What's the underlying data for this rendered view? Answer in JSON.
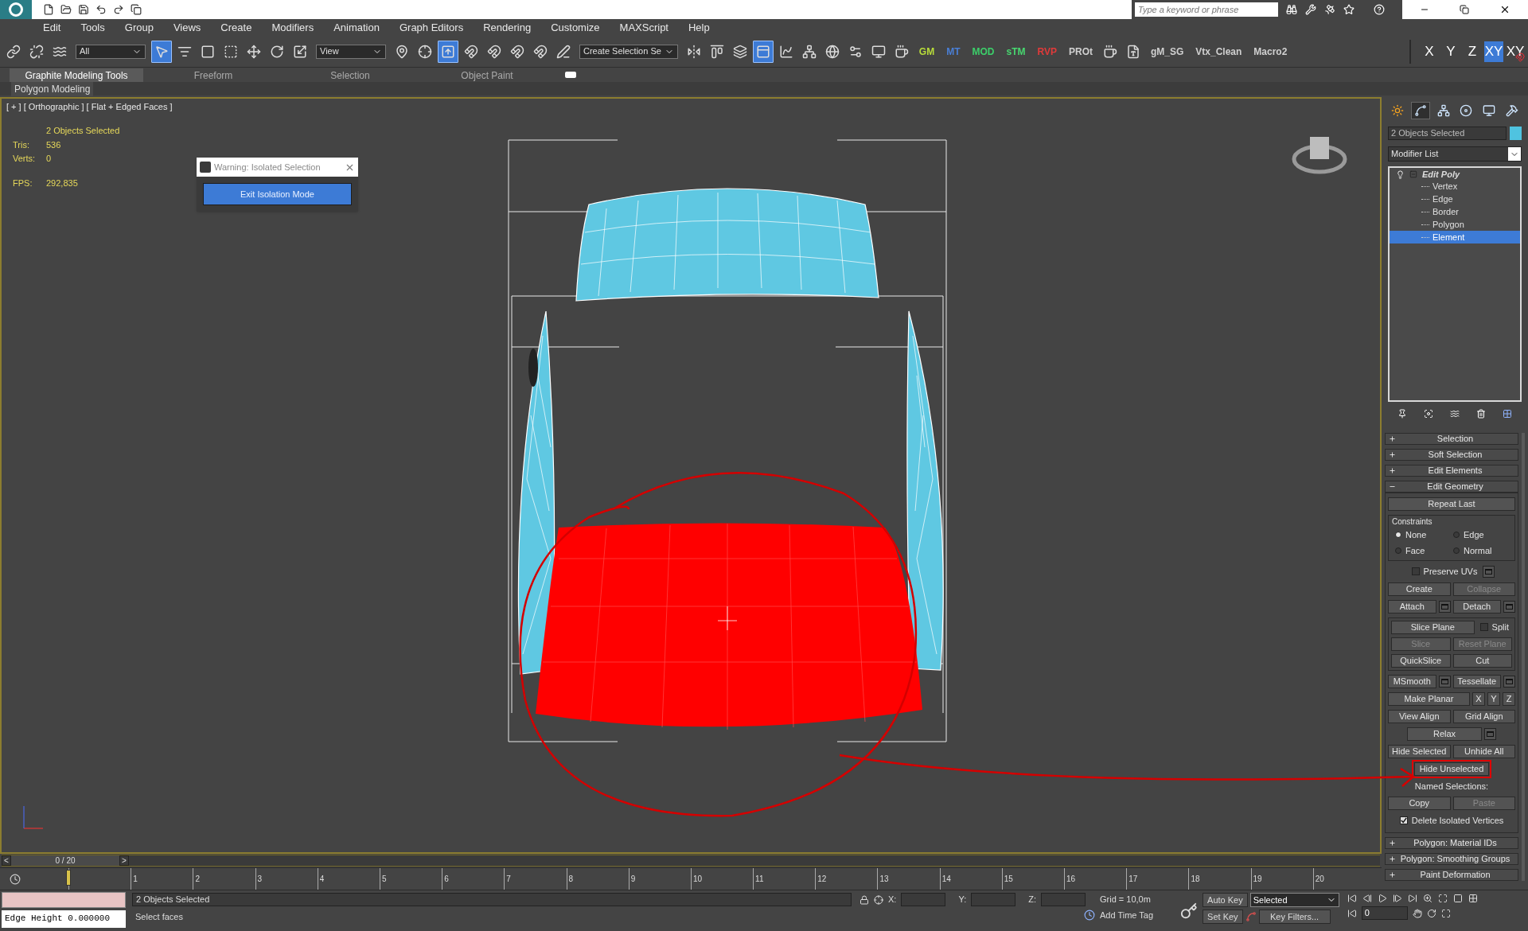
{
  "app": {
    "search_placeholder": "Type a keyword or phrase"
  },
  "menu": [
    "Edit",
    "Tools",
    "Group",
    "Views",
    "Create",
    "Modifiers",
    "Animation",
    "Graph Editors",
    "Rendering",
    "Customize",
    "MAXScript",
    "Help"
  ],
  "toolbar": [
    {
      "kind": "tool",
      "selected": false
    },
    {
      "kind": "tool",
      "selected": false
    },
    {
      "kind": "tool",
      "selected": false
    },
    {
      "kind": "dropdown",
      "value": "All"
    },
    {
      "kind": "tool",
      "selected": true
    },
    {
      "kind": "tool",
      "selected": false
    },
    {
      "kind": "tool",
      "selected": false
    },
    {
      "kind": "tool",
      "selected": false
    },
    {
      "kind": "tool",
      "selected": false
    },
    {
      "kind": "tool",
      "selected": false
    },
    {
      "kind": "tool",
      "selected": false
    },
    {
      "kind": "dropdown",
      "value": "View"
    },
    {
      "kind": "tool",
      "selected": false
    },
    {
      "kind": "tool",
      "selected": false
    },
    {
      "kind": "tool",
      "selected": true
    },
    {
      "kind": "tool",
      "selected": false
    },
    {
      "kind": "tool",
      "selected": false
    },
    {
      "kind": "tool",
      "selected": false
    },
    {
      "kind": "tool",
      "selected": false
    },
    {
      "kind": "tool",
      "selected": false
    },
    {
      "kind": "dropdown",
      "value": "Create Selection Se"
    },
    {
      "kind": "tool",
      "selected": false
    },
    {
      "kind": "tool",
      "selected": false
    },
    {
      "kind": "tool",
      "selected": false
    },
    {
      "kind": "tool",
      "selected": true
    },
    {
      "kind": "tool",
      "selected": false
    },
    {
      "kind": "tool",
      "selected": false
    },
    {
      "kind": "tool",
      "selected": false
    },
    {
      "kind": "tool",
      "selected": false
    },
    {
      "kind": "tool",
      "selected": false
    },
    {
      "kind": "tool",
      "selected": false
    },
    {
      "kind": "macro",
      "label": "GM",
      "color": "#b8dc3a"
    },
    {
      "kind": "macro",
      "label": "MT",
      "color": "#4a7fd6"
    },
    {
      "kind": "macro",
      "label": "MOD",
      "color": "#3ccf6a"
    },
    {
      "kind": "macro",
      "label": "sTM",
      "color": "#48d870"
    },
    {
      "kind": "macro",
      "label": "RVP",
      "color": "#e03a3a"
    },
    {
      "kind": "macro",
      "label": "PROt",
      "color": "#d0d0d0"
    },
    {
      "kind": "tool",
      "selected": false
    },
    {
      "kind": "tool",
      "selected": false
    },
    {
      "kind": "macro",
      "label": "gM_SG",
      "color": "#d0d0d0"
    },
    {
      "kind": "macro",
      "label": "Vtx_Clean",
      "color": "#d0d0d0"
    },
    {
      "kind": "macro",
      "label": "Macro2",
      "color": "#d0d0d0"
    }
  ],
  "axes": [
    {
      "kind": "axis",
      "label": "X",
      "selected": false
    },
    {
      "kind": "axis",
      "label": "Y",
      "selected": false
    },
    {
      "kind": "axis",
      "label": "Z",
      "selected": false
    },
    {
      "kind": "axis",
      "label": "XY",
      "selected": true
    },
    {
      "kind": "snap",
      "label": "XY",
      "selected": false
    }
  ],
  "ribbon": {
    "tabs": [
      {
        "label": "Graphite Modeling Tools",
        "selected": true
      },
      {
        "label": "Freeform",
        "selected": false
      },
      {
        "label": "Selection",
        "selected": false
      },
      {
        "label": "Object Paint",
        "selected": false
      }
    ],
    "panel": "Polygon Modeling"
  },
  "viewport": {
    "label": "[ + ] [ Orthographic ] [ Flat + Edged Faces ]",
    "stats": [
      {
        "value": "2 Objects Selected"
      },
      {
        "label": "Tris:",
        "value": "536"
      },
      {
        "label": "Verts:",
        "value": "0"
      },
      {
        "label": "FPS:",
        "value": "292,835"
      }
    ]
  },
  "dialog": {
    "title": "Warning: Isolated Selection",
    "button": "Exit Isolation Mode"
  },
  "command_panel": {
    "tabs": [
      {
        "selected": false
      },
      {
        "selected": true
      },
      {
        "selected": false
      },
      {
        "selected": false
      },
      {
        "selected": false
      },
      {
        "selected": false
      }
    ],
    "object_name": "2 Objects Selected",
    "modifier_list": "Modifier List",
    "stack": {
      "label": "Edit Poly",
      "expanded": true,
      "children": [
        {
          "label": "Vertex",
          "selected": false
        },
        {
          "label": "Edge",
          "selected": false
        },
        {
          "label": "Border",
          "selected": false
        },
        {
          "label": "Polygon",
          "selected": false
        },
        {
          "label": "Element",
          "selected": true
        }
      ]
    },
    "rollouts_top": [
      {
        "title": "Selection",
        "expanded": false
      },
      {
        "title": "Soft Selection",
        "expanded": false
      },
      {
        "title": "Edit Elements",
        "expanded": false
      },
      {
        "title": "Edit Geometry",
        "expanded": true
      }
    ],
    "edit_geometry": {
      "repeat_last": "Repeat Last",
      "constraints": {
        "title": "Constraints",
        "options": [
          {
            "label": "None",
            "selected": true
          },
          {
            "label": "Edge",
            "selected": false
          },
          {
            "label": "Face",
            "selected": false
          },
          {
            "label": "Normal",
            "selected": false
          }
        ]
      },
      "rows_a": [
        [
          {
            "kind": "check",
            "label": "Preserve UVs",
            "checked": false
          },
          {
            "kind": "settings"
          }
        ],
        [
          {
            "kind": "button",
            "label": "Create",
            "disabled": false
          },
          {
            "kind": "button",
            "label": "Collapse",
            "disabled": true
          }
        ],
        [
          {
            "kind": "button",
            "label": "Attach",
            "disabled": false
          },
          {
            "kind": "settings"
          },
          {
            "kind": "button",
            "label": "Detach",
            "disabled": false
          },
          {
            "kind": "settings"
          }
        ]
      ],
      "slice_rows": [
        [
          {
            "kind": "button",
            "label": "Slice Plane",
            "disabled": false
          },
          {
            "kind": "check",
            "label": "Split",
            "checked": false
          }
        ],
        [
          {
            "kind": "button",
            "label": "Slice",
            "disabled": true
          },
          {
            "kind": "button",
            "label": "Reset Plane",
            "disabled": true
          }
        ],
        [
          {
            "kind": "button",
            "label": "QuickSlice",
            "disabled": false
          },
          {
            "kind": "button",
            "label": "Cut",
            "disabled": false
          }
        ]
      ],
      "rows_b": [
        [
          {
            "kind": "button",
            "label": "MSmooth",
            "disabled": false
          },
          {
            "kind": "settings"
          },
          {
            "kind": "button",
            "label": "Tessellate",
            "disabled": false
          },
          {
            "kind": "settings"
          }
        ],
        [
          {
            "kind": "button",
            "label": "Make Planar",
            "disabled": false
          },
          {
            "kind": "short",
            "label": "X"
          },
          {
            "kind": "short",
            "label": "Y"
          },
          {
            "kind": "short",
            "label": "Z"
          }
        ],
        [
          {
            "kind": "button",
            "label": "View Align",
            "disabled": false
          },
          {
            "kind": "button",
            "label": "Grid Align",
            "disabled": false
          }
        ],
        [
          {
            "kind": "center",
            "label": "Relax"
          },
          {
            "kind": "settings"
          }
        ],
        [
          {
            "kind": "button",
            "label": "Hide Selected",
            "disabled": false
          },
          {
            "kind": "button",
            "label": "Unhide All",
            "disabled": false
          }
        ],
        [
          {
            "kind": "center",
            "label": "Hide Unselected",
            "annotated": true
          }
        ],
        [
          {
            "kind": "text",
            "label": "Named Selections:"
          }
        ],
        [
          {
            "kind": "button",
            "label": "Copy",
            "disabled": false
          },
          {
            "kind": "button",
            "label": "Paste",
            "disabled": true
          }
        ],
        [
          {
            "kind": "check",
            "label": "Delete Isolated Vertices",
            "checked": true
          }
        ]
      ]
    },
    "rollouts_bottom": [
      {
        "title": "Polygon: Material IDs",
        "expanded": false
      },
      {
        "title": "Polygon: Smoothing Groups",
        "expanded": false
      },
      {
        "title": "Paint Deformation",
        "expanded": false
      }
    ]
  },
  "timeline": {
    "frame": "0 / 20",
    "prev": "<",
    "next": ">",
    "level": 0,
    "ticks": [
      "1",
      "2",
      "3",
      "4",
      "5",
      "6",
      "7",
      "8",
      "9",
      "10",
      "11",
      "12",
      "13",
      "14",
      "15",
      "16",
      "17",
      "18",
      "19",
      "20"
    ]
  },
  "status": {
    "listener": "Edge Height 0.000000",
    "selection": "2 Objects Selected",
    "prompt": "Select faces",
    "x_label": "X:",
    "y_label": "Y:",
    "z_label": "Z:",
    "grid": "Grid = 10,0m",
    "add_time_tag": "Add Time Tag",
    "auto_key": "Auto Key",
    "set_key": "Set Key",
    "key_mode": "Selected",
    "key_filters": "Key Filters...",
    "current_frame": "0"
  }
}
